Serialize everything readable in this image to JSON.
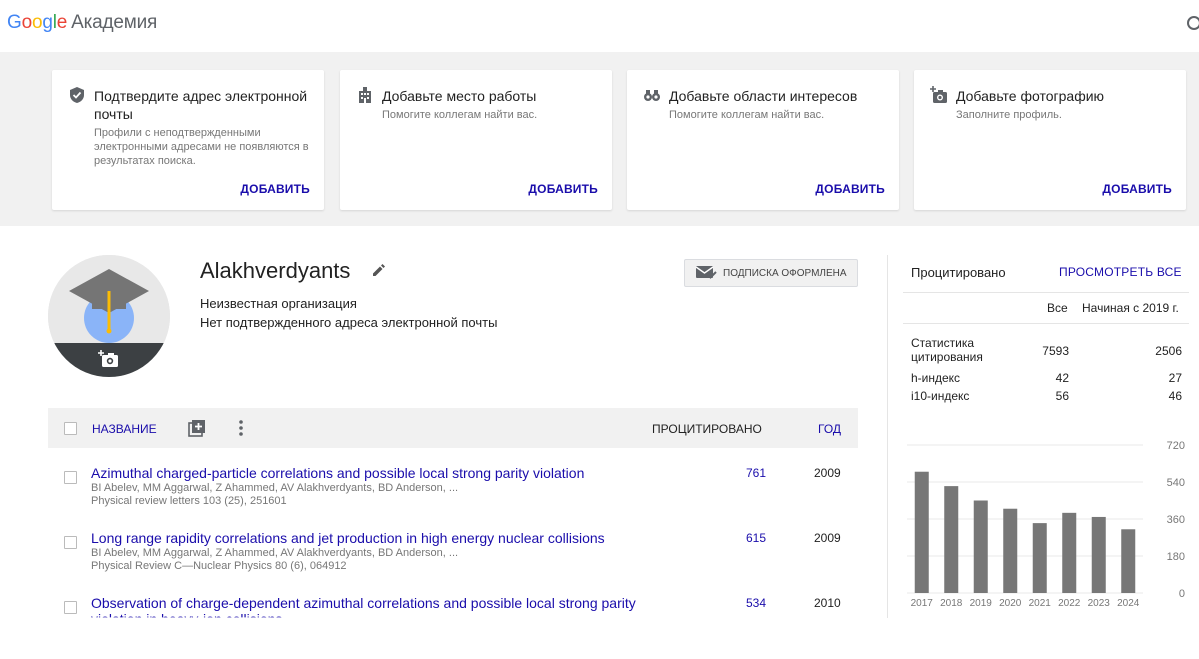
{
  "header": {
    "logo_google": [
      "G",
      "o",
      "o",
      "g",
      "l",
      "e"
    ],
    "logo_product": "Академия"
  },
  "banner": {
    "cards": [
      {
        "icon": "shield-check-icon",
        "title": "Подтвердите адрес электронной почты",
        "text": "Профили с неподтвержденными электронными адресами не появляются в результатах поиска.",
        "action": "ДОБАВИТЬ"
      },
      {
        "icon": "building-icon",
        "title": "Добавьте место работы",
        "text": "Помогите коллегам найти вас.",
        "action": "ДОБАВИТЬ"
      },
      {
        "icon": "binoculars-icon",
        "title": "Добавьте области интересов",
        "text": "Помогите коллегам найти вас.",
        "action": "ДОБАВИТЬ"
      },
      {
        "icon": "add-photo-icon",
        "title": "Добавьте фотографию",
        "text": "Заполните профиль.",
        "action": "ДОБАВИТЬ"
      }
    ]
  },
  "profile": {
    "name": "Alakhverdyants",
    "affiliation": "Неизвестная организация",
    "email": "Нет подтвержденного адреса электронной почты",
    "follow_label": "ПОДПИСКА ОФОРМЛЕНА"
  },
  "table": {
    "col_title": "НАЗВАНИЕ",
    "col_cited": "ПРОЦИТИРОВАНО",
    "col_year": "ГОД",
    "rows": [
      {
        "title": "Azimuthal charged-particle correlations and possible local strong parity violation",
        "authors": "BI Abelev, MM Aggarwal, Z Ahammed, AV Alakhverdyants, BD Anderson, ...",
        "venue": "Physical review letters 103 (25), 251601",
        "cited": "761",
        "year": "2009"
      },
      {
        "title": "Long range rapidity correlations and jet production in high energy nuclear collisions",
        "authors": "BI Abelev, MM Aggarwal, Z Ahammed, AV Alakhverdyants, BD Anderson, ...",
        "venue": "Physical Review C—Nuclear Physics 80 (6), 064912",
        "cited": "615",
        "year": "2009"
      },
      {
        "title": "Observation of charge-dependent azimuthal correlations and possible local strong parity",
        "title_cont": "violation in heavy-ion collisions",
        "cited": "534",
        "year": "2010"
      }
    ]
  },
  "citations": {
    "title": "Процитировано",
    "view_all": "ПРОСМОТРЕТЬ ВСЕ",
    "col_all": "Все",
    "col_since": "Начиная с 2019 г.",
    "stats": [
      {
        "label": "Статистика цитирования",
        "all": "7593",
        "since": "2506"
      },
      {
        "label": "h-индекс",
        "all": "42",
        "since": "27"
      },
      {
        "label": "i10-индекс",
        "all": "56",
        "since": "46"
      }
    ]
  },
  "chart_data": {
    "type": "bar",
    "categories": [
      "2017",
      "2018",
      "2019",
      "2020",
      "2021",
      "2022",
      "2023",
      "2024"
    ],
    "values": [
      590,
      520,
      450,
      410,
      340,
      390,
      370,
      310
    ],
    "yticks": [
      0,
      180,
      360,
      540,
      720
    ],
    "ylim": [
      0,
      720
    ],
    "bar_color": "#777777"
  }
}
